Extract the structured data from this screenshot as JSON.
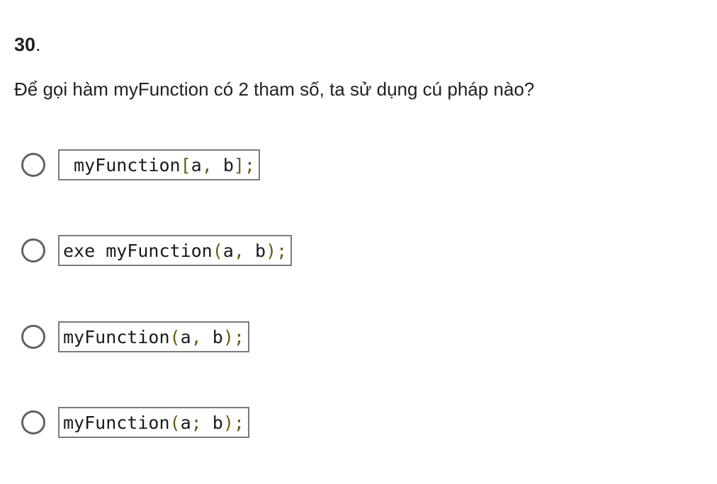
{
  "question": {
    "number": "30",
    "number_suffix": ".",
    "text": "Để gọi hàm myFunction có 2 tham số, ta sử dụng cú pháp nào?"
  },
  "options": [
    {
      "parts": [
        {
          "t": " myFunction",
          "p": false
        },
        {
          "t": "[",
          "p": true
        },
        {
          "t": "a",
          "p": false
        },
        {
          "t": ",",
          "p": true
        },
        {
          "t": " b",
          "p": false
        },
        {
          "t": "];",
          "p": true
        }
      ]
    },
    {
      "parts": [
        {
          "t": "exe myFunction",
          "p": false
        },
        {
          "t": "(",
          "p": true
        },
        {
          "t": "a",
          "p": false
        },
        {
          "t": ",",
          "p": true
        },
        {
          "t": " b",
          "p": false
        },
        {
          "t": ");",
          "p": true
        }
      ]
    },
    {
      "parts": [
        {
          "t": "myFunction",
          "p": false
        },
        {
          "t": "(",
          "p": true
        },
        {
          "t": "a",
          "p": false
        },
        {
          "t": ",",
          "p": true
        },
        {
          "t": " b",
          "p": false
        },
        {
          "t": ");",
          "p": true
        }
      ]
    },
    {
      "parts": [
        {
          "t": "myFunction",
          "p": false
        },
        {
          "t": "(",
          "p": true
        },
        {
          "t": "a",
          "p": false
        },
        {
          "t": ";",
          "p": true
        },
        {
          "t": " b",
          "p": false
        },
        {
          "t": ");",
          "p": true
        }
      ]
    }
  ]
}
